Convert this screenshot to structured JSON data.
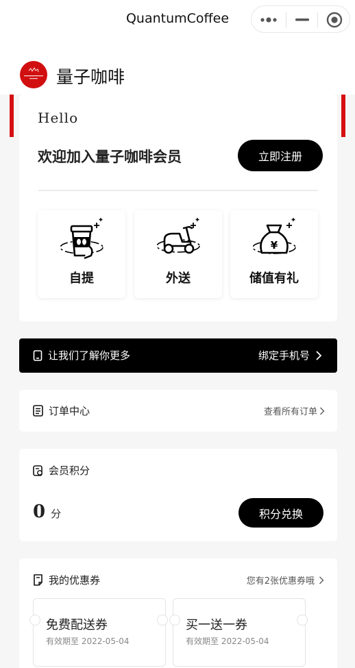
{
  "topbar": {
    "title": "QuantumCoffee"
  },
  "header": {
    "brand": "量子咖啡"
  },
  "hero": {
    "greeting": "Hello",
    "welcome": "欢迎加入量子咖啡会员",
    "register_label": "立即注册",
    "services": [
      {
        "label": "自提",
        "icon": "coffee-cup-icon"
      },
      {
        "label": "外送",
        "icon": "scooter-icon"
      },
      {
        "label": "储值有礼",
        "icon": "money-bag-icon"
      }
    ]
  },
  "bind_bar": {
    "text": "让我们了解你更多",
    "action": "绑定手机号"
  },
  "orders": {
    "title": "订单中心",
    "link": "查看所有订单"
  },
  "points": {
    "title": "会员积分",
    "value": "0",
    "unit": "分",
    "button": "积分兑换"
  },
  "coupons": {
    "title": "我的优惠券",
    "link": "您有2张优惠券哦",
    "items": [
      {
        "name": "免费配送券",
        "expiry": "有效期至 2022-05-04"
      },
      {
        "name": "买一送一券",
        "expiry": "有效期至 2022-05-04"
      }
    ]
  },
  "colors": {
    "accent": "#d50f12",
    "primary": "#000000",
    "background": "#f6f6f6"
  }
}
